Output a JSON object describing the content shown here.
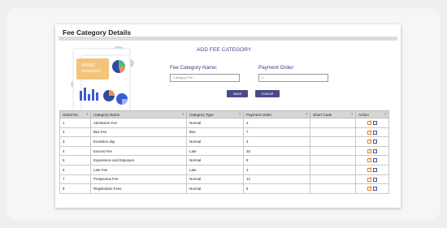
{
  "page": {
    "title": "Fee Category Details"
  },
  "form": {
    "heading": "ADD FEE CATEGORY",
    "category_label": "Fee Category Name:",
    "order_label": "Payment Order:",
    "category_placeholder": "Category Fee",
    "order_placeholder": "0",
    "save_label": "Save",
    "cancel_label": "Cancel"
  },
  "table": {
    "headers": [
      "Serial No",
      "Category Name",
      "Category Type",
      "Payment Order",
      "Short Code",
      "Action"
    ],
    "rows": [
      {
        "serial": "1",
        "name": "Admission Fee",
        "type": "Normal",
        "order": "2",
        "code": ""
      },
      {
        "serial": "2",
        "name": "Bus Fee",
        "type": "Bus",
        "order": "7",
        "code": ""
      },
      {
        "serial": "3",
        "name": "Evolution day",
        "type": "Normal",
        "order": "4",
        "code": ""
      },
      {
        "serial": "4",
        "name": "Excess Fee",
        "type": "Late",
        "order": "25",
        "code": ""
      },
      {
        "serial": "5",
        "name": "Experience and Exposure",
        "type": "Normal",
        "order": "8",
        "code": ""
      },
      {
        "serial": "6",
        "name": "Late Fee",
        "type": "Late",
        "order": "3",
        "code": ""
      },
      {
        "serial": "7",
        "name": "Prospectus Fee",
        "type": "Normal",
        "order": "12",
        "code": ""
      },
      {
        "serial": "8",
        "name": "Registration Fees",
        "type": "Normal",
        "order": "6",
        "code": ""
      }
    ]
  },
  "icons": {
    "edit": "edit-icon",
    "delete": "delete-icon",
    "sort": "sort-icon"
  },
  "colors": {
    "accent": "#3c3f88",
    "button": "#4a4a8a",
    "edit": "#e8822e"
  }
}
